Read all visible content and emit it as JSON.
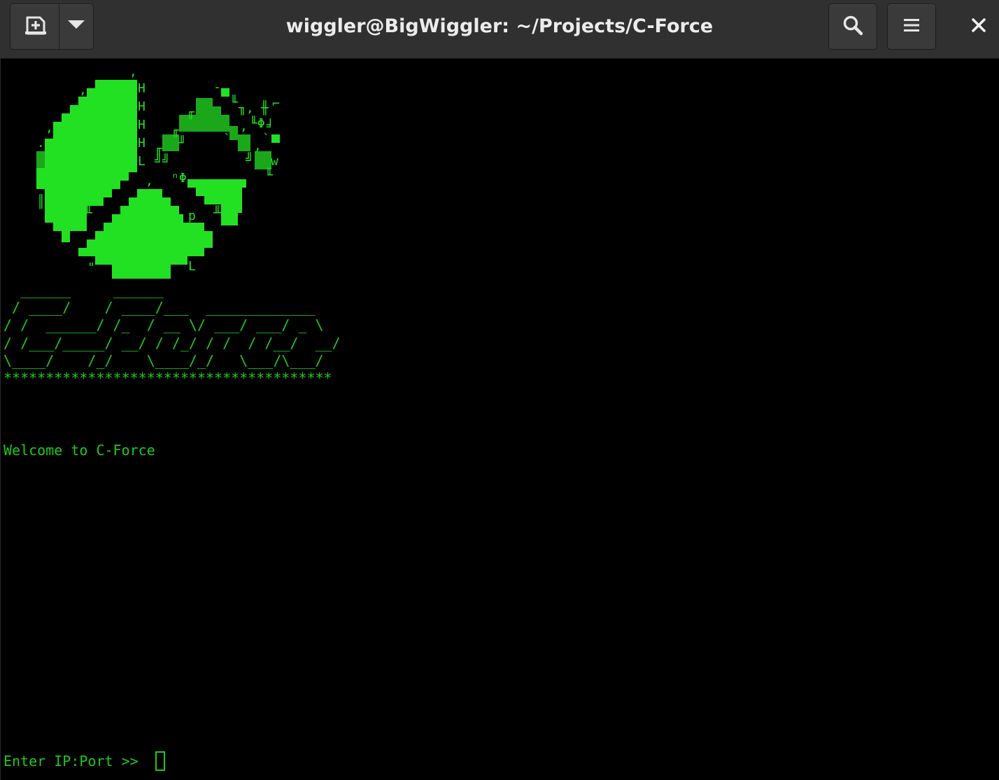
{
  "window": {
    "title": "wiggler@BigWiggler: ~/Projects/C-Force"
  },
  "toolbar": {
    "new_tab_icon": "new-tab-icon",
    "tab_menu_icon": "chevron-down-icon",
    "search_icon": "search-icon",
    "menu_icon": "hamburger-menu-icon",
    "close_icon": "close-icon"
  },
  "terminal": {
    "banner_lines": [
      "  ______     ______",
      " / ____/    / ____/___  _____________",
      "/ /  ______/ /_  / __ \\/ ___/ ___/ _ \\",
      "/ /___/_____/ __/ / /_/ / /  / /__/  __/",
      "\\____/    /_/    \\____/_/   \\___/\\___/",
      "***************************************"
    ],
    "welcome_text": "Welcome to C-Force",
    "prompt_text": "Enter IP:Port >> ",
    "input_value": ""
  },
  "colors": {
    "terminal_fg": "#1ec81e",
    "terminal_bg": "#000000",
    "titlebar_bg": "#303030",
    "title_fg": "#ececec"
  }
}
